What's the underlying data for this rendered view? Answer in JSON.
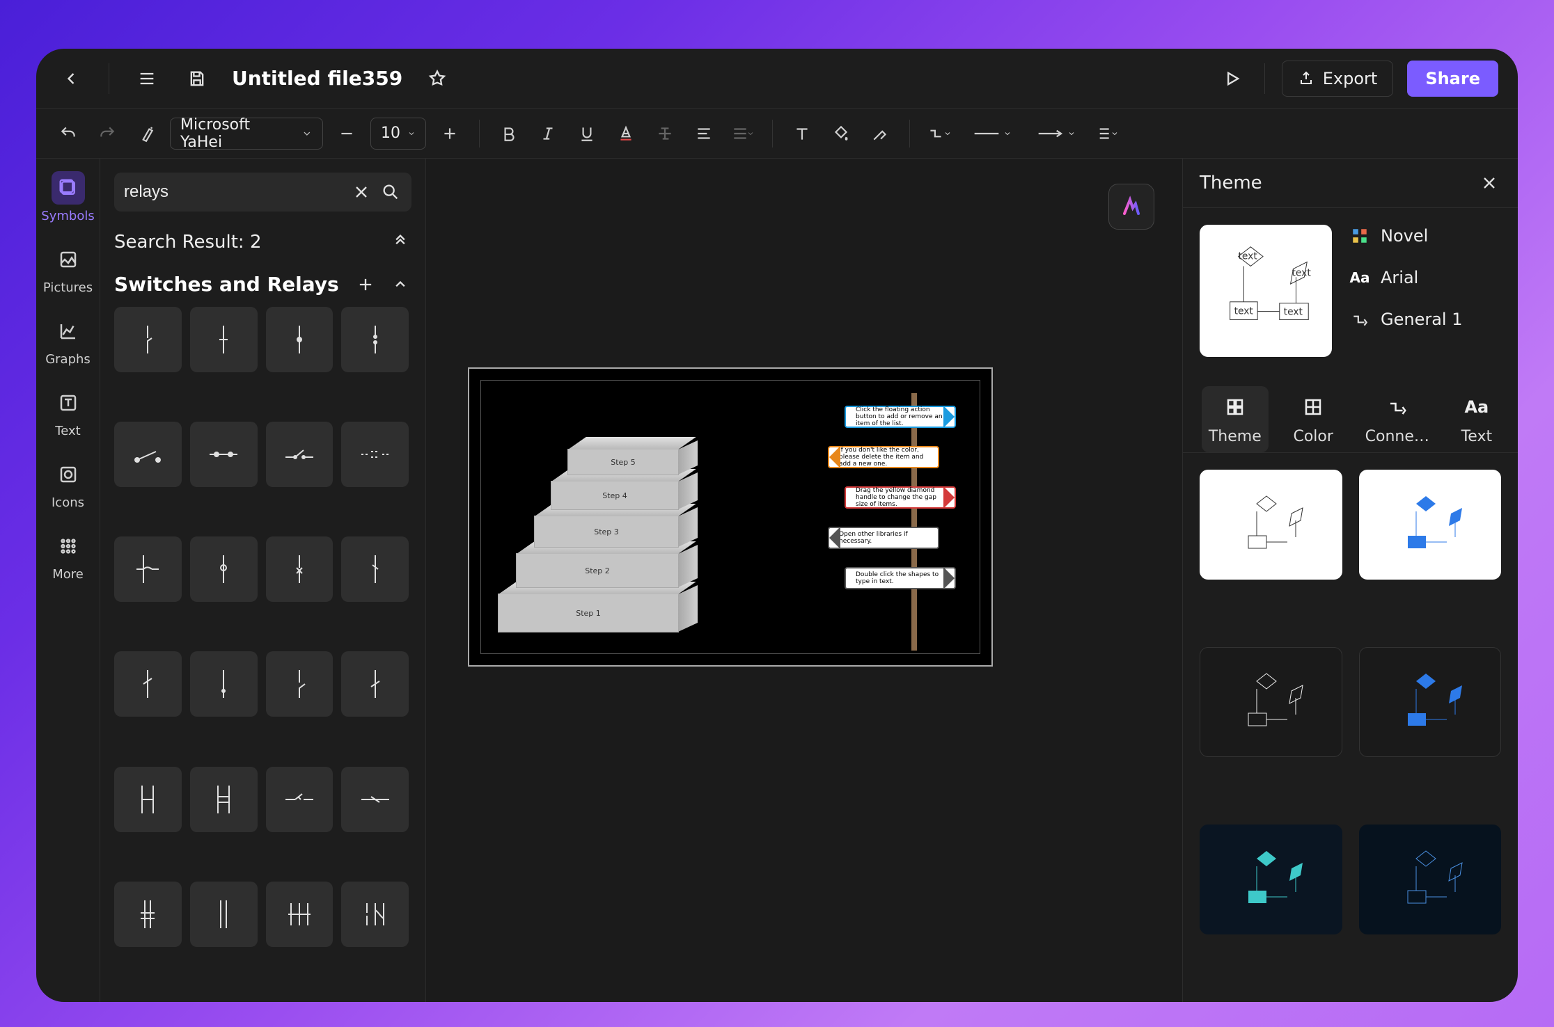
{
  "title": "Untitled file359",
  "export_label": "Export",
  "share_label": "Share",
  "font_name": "Microsoft YaHei",
  "font_size": "10",
  "rail": {
    "symbols": "Symbols",
    "pictures": "Pictures",
    "graphs": "Graphs",
    "text": "Text",
    "icons": "Icons",
    "more": "More"
  },
  "search_value": "relays",
  "search_result_label": "Search Result: 2",
  "category_label": "Switches and Relays",
  "canvas": {
    "steps": [
      "Step 1",
      "Step 2",
      "Step 3",
      "Step 4",
      "Step 5"
    ],
    "signs": [
      "Click the floating action button to add or remove an item of the list.",
      "If you don't like the color, please delete the item and add a new one.",
      "Drag the yellow diamond handle to change the gap size of items.",
      "Open other libraries if necessary.",
      "Double click the shapes to type in text."
    ]
  },
  "theme": {
    "panel_title": "Theme",
    "ov_name": "Novel",
    "ov_font": "Arial",
    "ov_conn": "General 1",
    "tabs": {
      "theme": "Theme",
      "color": "Color",
      "connector": "Conne…",
      "text": "Text"
    }
  }
}
